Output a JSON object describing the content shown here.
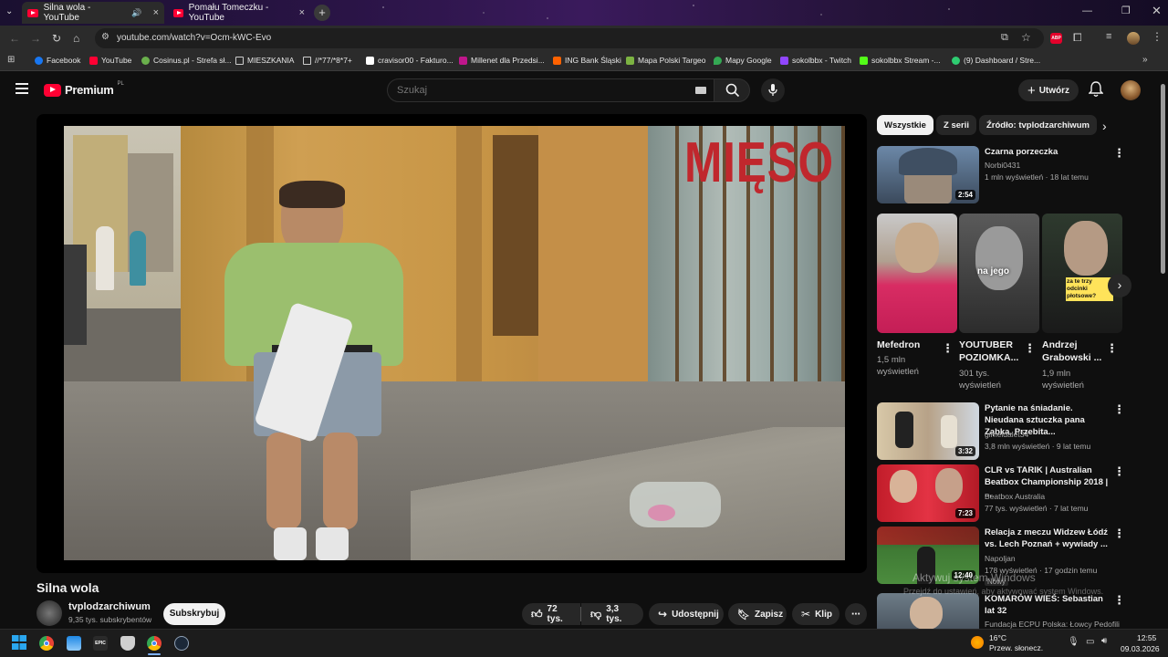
{
  "browser": {
    "tabs": [
      {
        "title": "Silna wola - YouTube",
        "active": true
      },
      {
        "title": "Pomału Tomeczku - YouTube",
        "active": false
      }
    ],
    "url": "youtube.com/watch?v=Ocm-kWC-Evo",
    "bookmarks": [
      {
        "label": "Facebook",
        "color": "#1877f2"
      },
      {
        "label": "YouTube",
        "color": "#ff0033"
      },
      {
        "label": "Cosinus.pl - Strefa sł...",
        "color": "#6ab04c"
      },
      {
        "label": "MIESZKANIA",
        "color": "folder"
      },
      {
        "label": "//*77/*8*7+",
        "color": "folder"
      },
      {
        "label": "cravisor00 - Fakturo...",
        "color": "#ffffff"
      },
      {
        "label": "Millenet dla Przedsi...",
        "color": "#c0168c"
      },
      {
        "label": "ING Bank Śląski",
        "color": "#ff6200"
      },
      {
        "label": "Mapa Polski Targeo",
        "color": "#7cb342"
      },
      {
        "label": "Mapy Google",
        "color": "#34a853"
      },
      {
        "label": "sokolbbx - Twitch",
        "color": "#9146ff"
      },
      {
        "label": "sokolbbx Stream -...",
        "color": "#53fc18"
      },
      {
        "label": "(9) Dashboard / Stre...",
        "color": "#2ecc71"
      }
    ],
    "adblock_badge": "ABP"
  },
  "youtube": {
    "logo_text": "Premium",
    "logo_suffix": "PL",
    "search_placeholder": "Szukaj",
    "create_label": "Utwórz",
    "video": {
      "title": "Silna wola",
      "channel": "tvplodzarchiwum",
      "subscribers": "9,35 tys. subskrybentów",
      "subscribe_label": "Subskrybuj",
      "likes": "72 tys.",
      "dislikes": "3,3 tys.",
      "share_label": "Udostępnij",
      "save_label": "Zapisz",
      "clip_label": "Klip",
      "sign_text": "MIĘSO"
    },
    "chips": [
      "Wszystkie",
      "Z serii",
      "Źródło: tvplodzarchiwum"
    ],
    "shorts": [
      {
        "title": "Mefedron",
        "meta": "1,5 mln wyświetleń",
        "overlay": ""
      },
      {
        "title": "YOUTUBER POZIOMKA...",
        "meta": "301 tys. wyświetleń",
        "overlay": "na jego"
      },
      {
        "title": "Andrzej Grabowski ...",
        "meta": "1,9 mln wyświetleń",
        "overlay": "za te trzy odcinki płotsowe?"
      }
    ],
    "recommended": [
      {
        "title": "Czarna porzeczka",
        "channel": "Norbi0431",
        "meta": "1 mln wyświetleń · 18 lat temu",
        "duration": "2:54"
      },
      {
        "title": "Pytanie na śniadanie. Nieudana sztuczka pana Ząbka. Przebita...",
        "channel": "gimeldalet34",
        "meta": "3,8 mln wyświetleń · 9 lat temu",
        "duration": "3:32"
      },
      {
        "title": "CLR vs TARIK | Australian Beatbox Championship 2018 | ...",
        "channel": "Beatbox Australia",
        "meta": "77 tys. wyświetleń · 7 lat temu",
        "duration": "7:23"
      },
      {
        "title": "Relacja z meczu Widzew Łódź vs. Lech Poznań + wywiady ...",
        "channel": "Napoljan",
        "meta": "178 wyświetleń · 17 godzin temu",
        "badge": "Nowy",
        "duration": "12:40"
      },
      {
        "title": "KOMARÓW WIEŚ: Sebastian lat 32",
        "channel": "Fundacja ECPU Polska: Łowcy Pedofili",
        "meta": "",
        "duration": ""
      }
    ]
  },
  "windows": {
    "watermark_title": "Aktywuj system Windows",
    "watermark_sub": "Przejdź do ustawień, aby aktywować system Windows.",
    "weather_temp": "16°C",
    "weather_desc": "Przew. słonecz.",
    "time": "12:55",
    "date": "09.03.2026"
  }
}
